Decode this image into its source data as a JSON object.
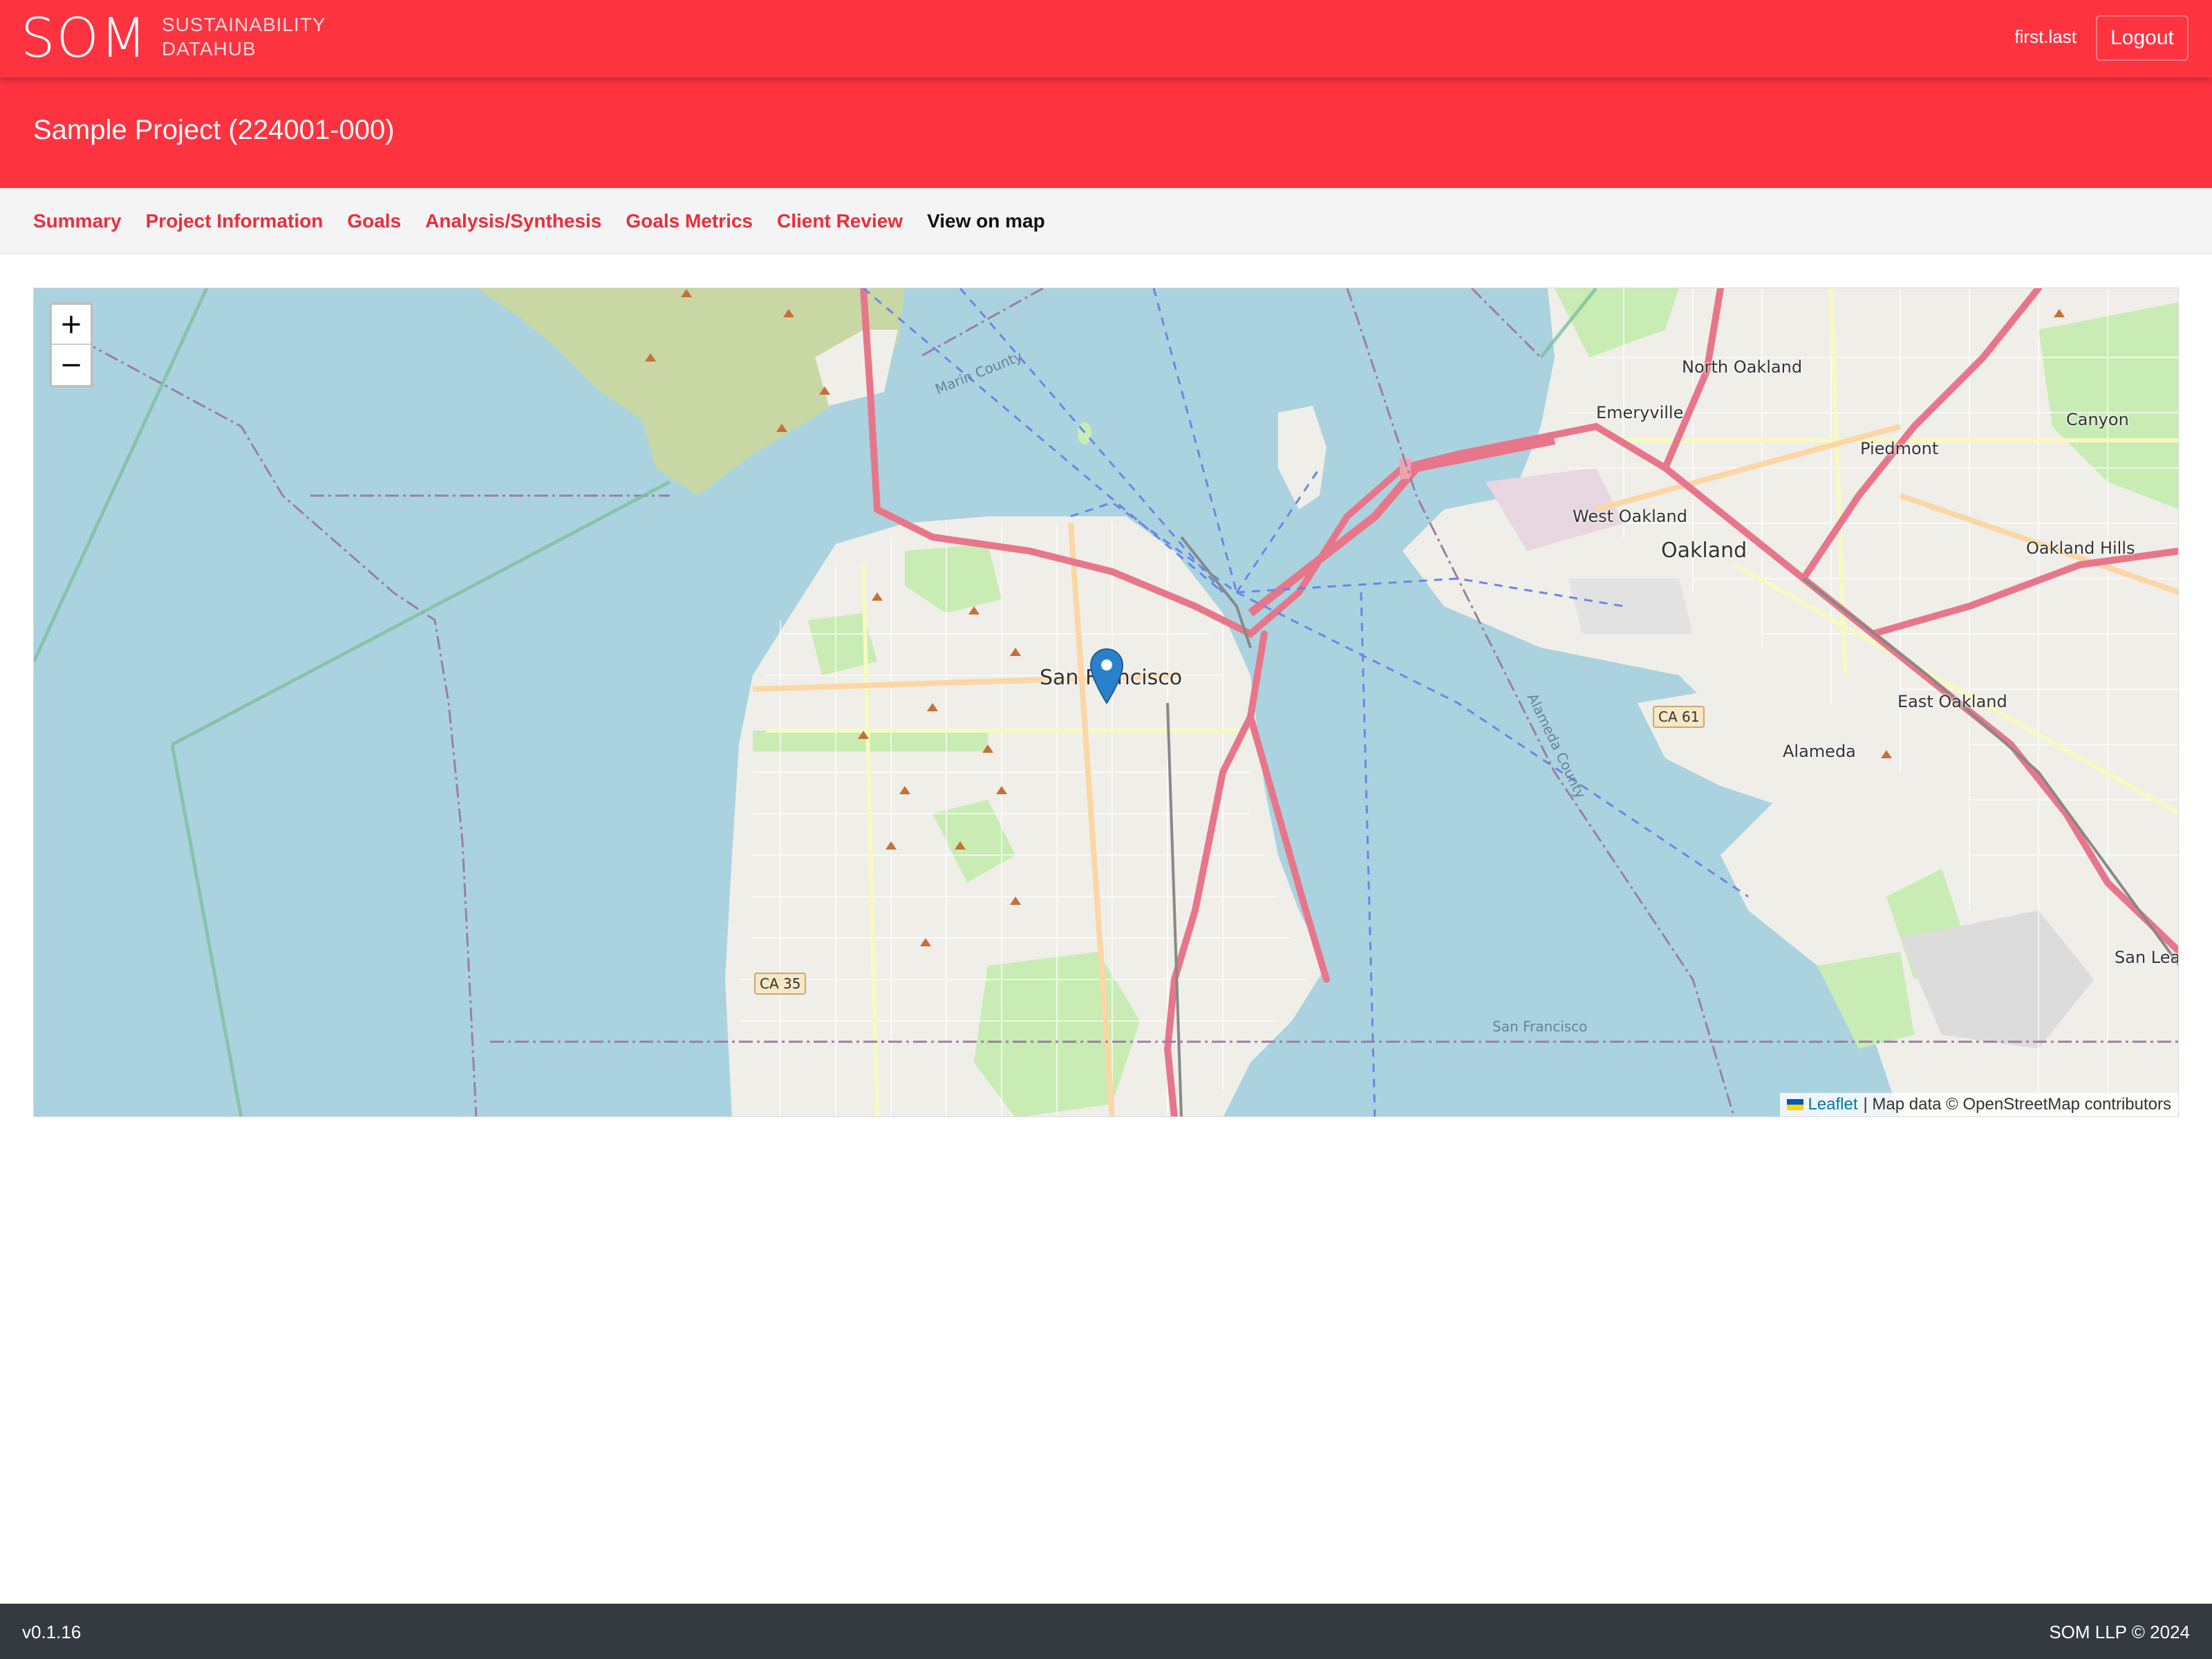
{
  "header": {
    "logo_main": "SOM",
    "logo_sub_line1": "SUSTAINABILITY",
    "logo_sub_line2": "DATAHUB",
    "username": "first.last",
    "logout_label": "Logout"
  },
  "project": {
    "title": "Sample Project (224001-000)"
  },
  "nav": {
    "tabs": [
      {
        "label": "Summary",
        "active": false
      },
      {
        "label": "Project Information",
        "active": false
      },
      {
        "label": "Goals",
        "active": false
      },
      {
        "label": "Analysis/Synthesis",
        "active": false
      },
      {
        "label": "Goals Metrics",
        "active": false
      },
      {
        "label": "Client Review",
        "active": false
      },
      {
        "label": "View on map",
        "active": true
      }
    ]
  },
  "map": {
    "zoom_in_label": "+",
    "zoom_out_label": "−",
    "attribution_link": "Leaflet",
    "attribution_text": "| Map data © OpenStreetMap contributors",
    "labels": {
      "san_francisco": "San Francisco",
      "oakland": "Oakland",
      "alameda": "Alameda",
      "emeryville": "Emeryville",
      "north_oakland": "North Oakland",
      "west_oakland": "West Oakland",
      "piedmont": "Piedmont",
      "east_oakland": "East Oakland",
      "oakland_hills": "Oakland Hills",
      "canyon": "Canyon",
      "san_leandro": "San Lea",
      "marin_county": "Marin County",
      "alameda_county": "Alameda County",
      "sf_boundary": "San Francisco",
      "ca35": "CA 35",
      "ca61": "CA 61"
    }
  },
  "footer": {
    "version": "v0.1.16",
    "copyright": "SOM LLP © 2024"
  },
  "colors": {
    "brand_red": "#fe3340",
    "tab_red": "#ec2d3b",
    "footer_dark": "#343a40",
    "water": "#aad3df",
    "marker_blue": "#2a81cb"
  }
}
